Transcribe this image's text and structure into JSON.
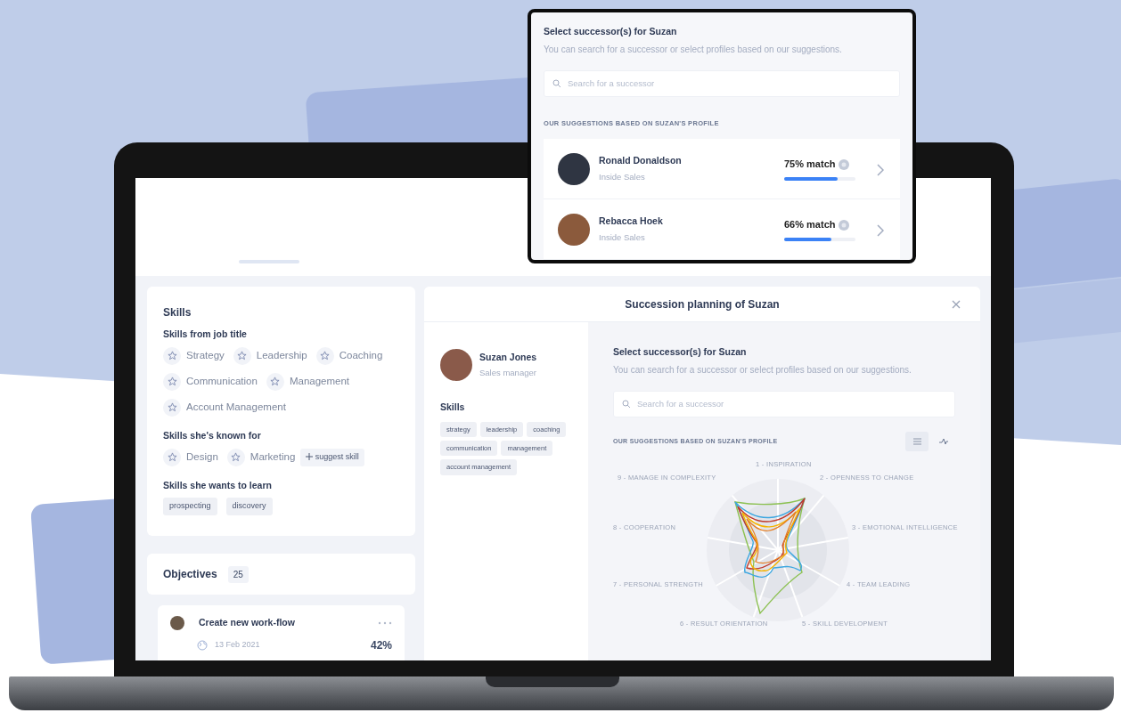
{
  "popup": {
    "title": "Select successor(s) for Suzan",
    "subtitle": "You can search for a successor or select profiles based on our suggestions.",
    "search": {
      "placeholder": "Search for a successor"
    },
    "section_label": "OUR SUGGESTIONS BASED ON SUZAN'S PROFILE",
    "candidates": [
      {
        "name": "Ronald Donaldson",
        "role": "Inside Sales",
        "match": "75% match",
        "level": 0.75
      },
      {
        "name": "Rebacca Hoek",
        "role": "Inside Sales",
        "match": "66% match",
        "level": 0.66
      }
    ]
  },
  "skills_card": {
    "title": "Skills",
    "groups": [
      {
        "title": "Skills from job title",
        "skills": [
          {
            "label": "Strategy",
            "kind": "star"
          },
          {
            "label": "Leadership",
            "kind": "star"
          },
          {
            "label": "Coaching",
            "kind": "star"
          },
          {
            "label": "Communication",
            "kind": "star"
          },
          {
            "label": "Management",
            "kind": "star"
          },
          {
            "label": "Account Management",
            "kind": "star"
          }
        ]
      },
      {
        "title": "Skills she's known for",
        "skills": [
          {
            "label": "Design",
            "kind": "star"
          },
          {
            "label": "Marketing",
            "kind": "star"
          },
          {
            "label": "suggest skill",
            "kind": "add"
          }
        ]
      },
      {
        "title": "Skills she wants to learn",
        "skills": [
          {
            "label": "prospecting",
            "kind": "tag"
          },
          {
            "label": "discovery",
            "kind": "tag"
          }
        ]
      }
    ]
  },
  "objectives": {
    "title": "Objectives",
    "count": "25",
    "items": [
      {
        "title": "Create new work-flow",
        "date": "13 Feb 2021",
        "progress": "42%"
      }
    ]
  },
  "succession_panel": {
    "title": "Succession planning of Suzan",
    "profile": {
      "name": "Suzan Jones",
      "role": "Sales manager"
    },
    "skills_title": "Skills",
    "skills": [
      "strategy",
      "leadership",
      "coaching",
      "communication",
      "management",
      "account management"
    ],
    "select_title": "Select successor(s) for Suzan",
    "select_subtitle": "You can search for a successor or select profiles based on our suggestions.",
    "search": {
      "placeholder": "Search for a successor"
    },
    "section_label": "OUR SUGGESTIONS BASED ON SUZAN'S PROFILE",
    "view_toggle": [
      {
        "kind": "list",
        "selected": true
      },
      {
        "kind": "chart",
        "selected": false
      }
    ],
    "radar_labels": [
      "1 - INSPIRATION",
      "9 - MANAGE IN COMPLEXITY",
      "2 - OPENNESS TO CHANGE",
      "8 - COOPERATION",
      "3 - EMOTIONAL INTELLIGENCE",
      "7 - PERSONAL STRENGTH",
      "4 - TEAM LEADING",
      "6 - RESULT ORIENTATION",
      "5 - SKILL DEVELOPMENT"
    ]
  }
}
